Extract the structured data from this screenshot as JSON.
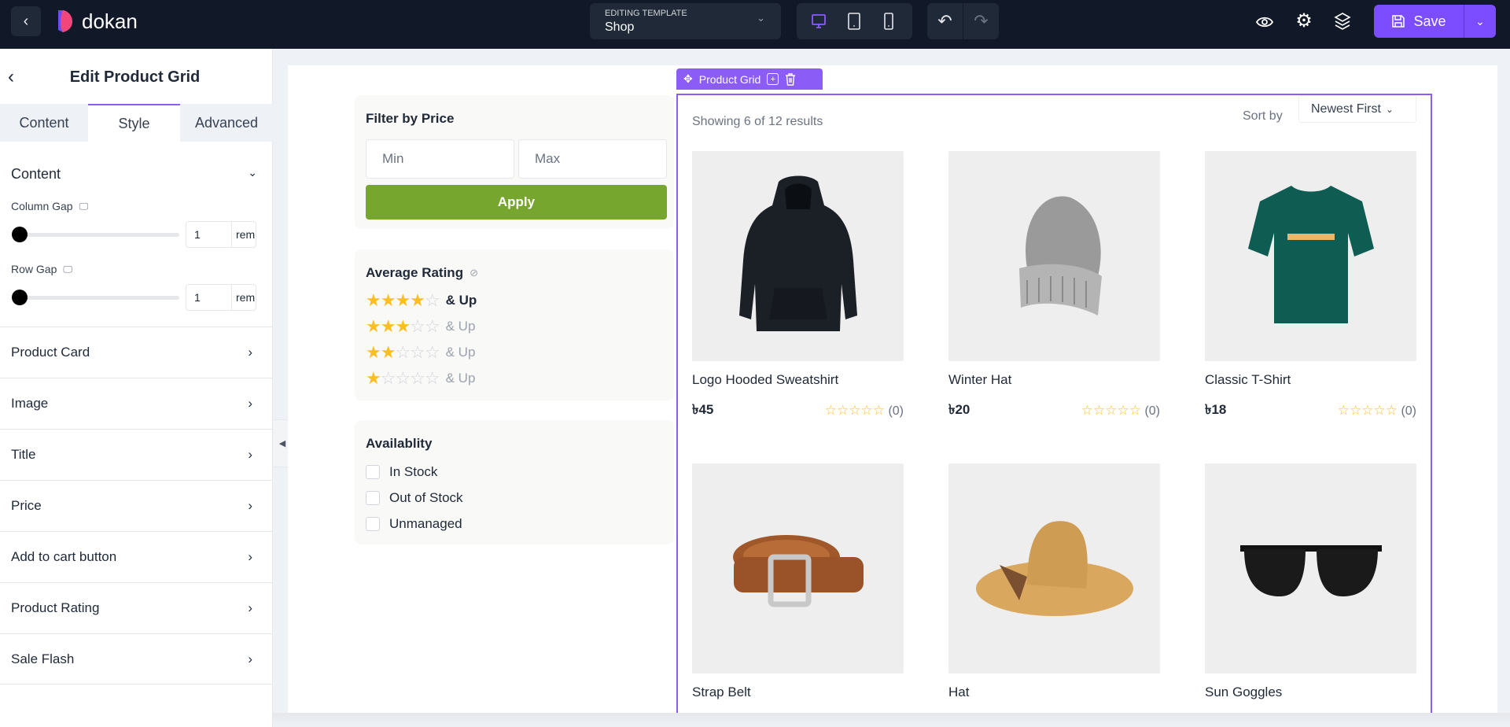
{
  "topbar": {
    "brand": "dokan",
    "template_label": "EDITING TEMPLATE",
    "template_value": "Shop",
    "save_label": "Save",
    "accent": "#7c4dff"
  },
  "sidebar": {
    "title": "Edit Product Grid",
    "tabs": [
      {
        "label": "Content"
      },
      {
        "label": "Style"
      },
      {
        "label": "Advanced"
      }
    ],
    "active_tab": "Style",
    "section": {
      "label": "Content",
      "column_gap": {
        "label": "Column Gap",
        "value": "1",
        "unit": "rem"
      },
      "row_gap": {
        "label": "Row Gap",
        "value": "1",
        "unit": "rem"
      }
    },
    "items": [
      {
        "label": "Product Card"
      },
      {
        "label": "Image"
      },
      {
        "label": "Title"
      },
      {
        "label": "Price"
      },
      {
        "label": "Add to cart button"
      },
      {
        "label": "Product Rating"
      },
      {
        "label": "Sale Flash"
      }
    ]
  },
  "filters": {
    "price": {
      "title": "Filter by Price",
      "min_placeholder": "Min",
      "max_placeholder": "Max",
      "apply": "Apply",
      "apply_color": "#77a62f"
    },
    "rating": {
      "title": "Average Rating",
      "rows": [
        {
          "stars": 4,
          "label": "& Up"
        },
        {
          "stars": 3,
          "label": "& Up"
        },
        {
          "stars": 2,
          "label": "& Up"
        },
        {
          "stars": 1,
          "label": "& Up"
        }
      ]
    },
    "availability": {
      "title": "Availablity",
      "options": [
        {
          "label": "In Stock"
        },
        {
          "label": "Out of Stock"
        },
        {
          "label": "Unmanaged"
        }
      ]
    }
  },
  "grid": {
    "widget_label": "Product Grid",
    "showing": "Showing 6 of 12 results",
    "sort_label": "Sort by",
    "sort_value": "Newest First",
    "products": [
      {
        "title": "Logo Hooded Sweatshirt",
        "price": "৳45",
        "rating": "☆☆☆☆☆",
        "count": "(0)",
        "image": "hoodie"
      },
      {
        "title": "Winter Hat",
        "price": "৳20",
        "rating": "☆☆☆☆☆",
        "count": "(0)",
        "image": "beanie"
      },
      {
        "title": "Classic T-Shirt",
        "price": "৳18",
        "rating": "☆☆☆☆☆",
        "count": "(0)",
        "image": "tshirt"
      },
      {
        "title": "Strap Belt",
        "image": "belt"
      },
      {
        "title": "Hat",
        "image": "sunhat"
      },
      {
        "title": "Sun Goggles",
        "image": "sunglasses"
      }
    ]
  }
}
